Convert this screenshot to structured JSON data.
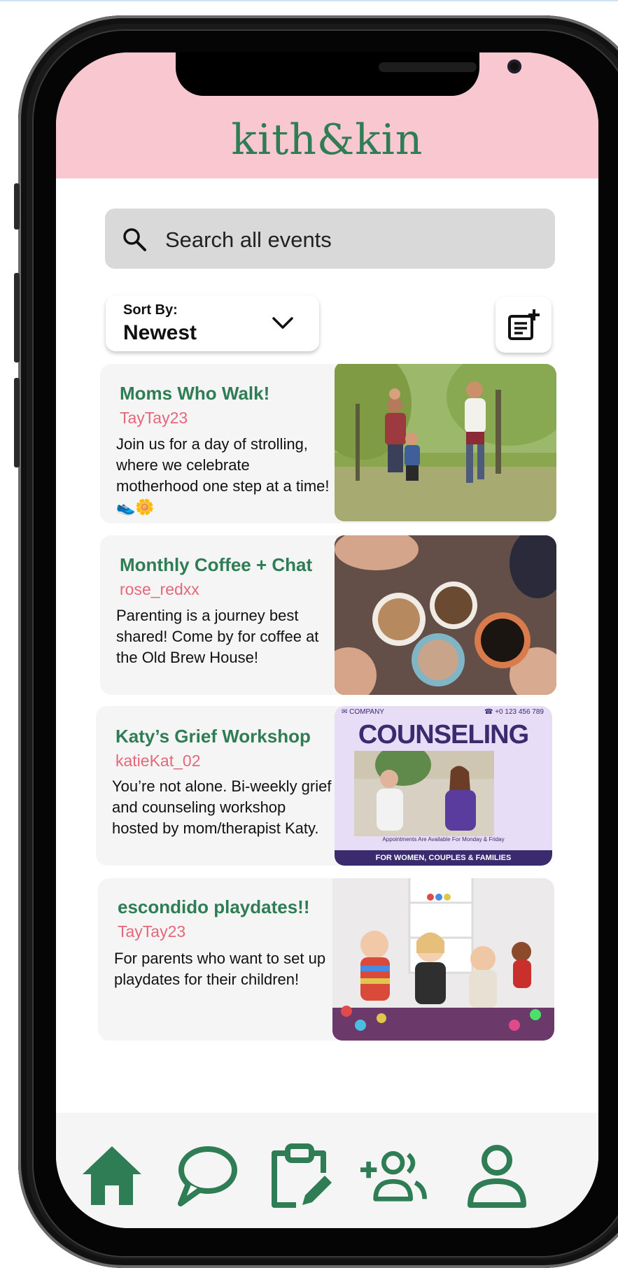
{
  "app": {
    "logo": "kith&kin"
  },
  "search": {
    "placeholder": "Search all events",
    "icon": "search-icon"
  },
  "sort": {
    "label": "Sort By:",
    "value": "Newest",
    "icon": "chevron-down-icon"
  },
  "toolbar": {
    "add_event_icon": "add-note-icon"
  },
  "events": [
    {
      "title": "Moms Who Walk!",
      "user": "TayTay23",
      "description": "Join us for a day of strolling, where we celebrate motherhood one step at a time! 👟🌼"
    },
    {
      "title": "Monthly Coffee + Chat",
      "user": "rose_redxx",
      "description": "Parenting is a journey best shared! Come by for coffee at the Old Brew House!"
    },
    {
      "title": "Katy’s Grief Workshop",
      "user": "katieKat_02",
      "description": "You’re not alone. Bi-weekly grief and counseling workshop hosted by mom/therapist Katy."
    },
    {
      "title": "escondido playdates!!",
      "user": "TayTay23",
      "description": "For parents who want to set up playdates for their children!"
    }
  ],
  "poster": {
    "company": "COMPANY",
    "phone": "+0 123 456 789",
    "headline": "COUNSELING",
    "note": "Appointments Are Available For Monday & Friday",
    "footer": "FOR WOMEN, COUPLES & FAMILIES"
  },
  "nav": {
    "items": [
      "home-icon",
      "chat-icon",
      "clipboard-edit-icon",
      "add-friends-icon",
      "profile-icon"
    ],
    "active": "home"
  },
  "colors": {
    "brand_green": "#2e7d55",
    "header_pink": "#f9c7cf",
    "username_pink": "#e5677a",
    "poster_purple": "#3a2a6e"
  }
}
